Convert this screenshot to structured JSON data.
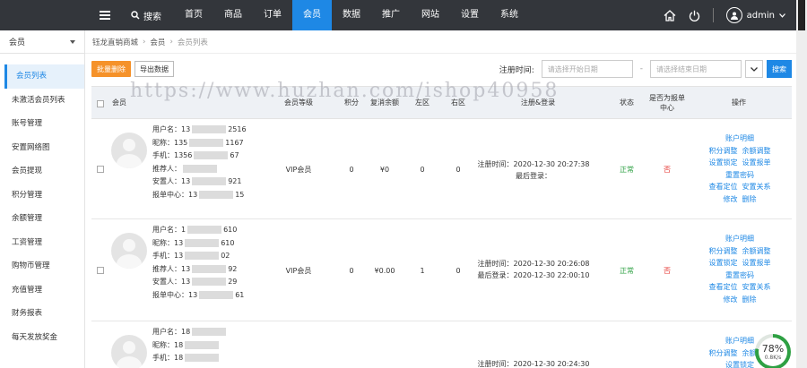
{
  "topbar": {
    "search_label": "搜索",
    "nav": [
      "首页",
      "商品",
      "订单",
      "会员",
      "数据",
      "推广",
      "网站",
      "设置",
      "系统"
    ],
    "active_nav_index": 3,
    "user": "admin"
  },
  "sidebar": {
    "select_value": "会员",
    "items": [
      "会员列表",
      "未激活会员列表",
      "账号管理",
      "安置网络图",
      "会员提现",
      "积分管理",
      "余额管理",
      "工资管理",
      "购物币管理",
      "充值管理",
      "财务报表",
      "每天发放奖金"
    ],
    "active_index": 0
  },
  "breadcrumb": [
    "钰龙直销商城",
    "会员",
    "会员列表"
  ],
  "toolbar": {
    "batch_delete": "批量删除",
    "export": "导出数据",
    "date_label": "注册时间:",
    "start_placeholder": "请选择开始日期",
    "end_placeholder": "请选择结束日期",
    "search": "搜索"
  },
  "watermark": "https://www.huzhan.com/ishop40958",
  "table": {
    "headers": {
      "member": "会员",
      "level": "会员等级",
      "points": "积分",
      "balance": "复消余额",
      "left": "左区",
      "right": "右区",
      "reg_login": "注册&登录",
      "status": "状态",
      "report_center": "是否为报单中心",
      "ops": "操作"
    },
    "info_labels": [
      "用户名：",
      "昵称：",
      "手机：",
      "推荐人：",
      "安置人：",
      "报单中心："
    ],
    "rows": [
      {
        "info": [
          "13",
          "2516",
          "135",
          "1167",
          "1356",
          "67",
          "",
          "",
          "13",
          "921",
          "13",
          "15"
        ],
        "level": "VIP会员",
        "points": "0",
        "balance": "¥0",
        "left": "0",
        "right": "0",
        "reg": "注册时间：2020-12-30 20:27:38",
        "login": "最后登录：",
        "status": "正常",
        "report": "否"
      },
      {
        "info": [
          "1",
          "610",
          "13",
          "610",
          "13",
          "02",
          "13",
          "92",
          "13",
          "29",
          "13",
          "61"
        ],
        "level": "VIP会员",
        "points": "0",
        "balance": "¥0.00",
        "left": "1",
        "right": "0",
        "reg": "注册时间：2020-12-30 20:26:08",
        "login": "最后登录：2020-12-30 22:00:10",
        "status": "正常",
        "report": "否"
      },
      {
        "info": [
          "18",
          "",
          "18",
          "",
          "18",
          ""
        ],
        "level": "",
        "points": "",
        "balance": "",
        "left": "",
        "right": "",
        "reg": "注册时间：2020-12-30 20:24:30",
        "login": "",
        "status": "",
        "report": ""
      }
    ],
    "ops": [
      "账户明细",
      "积分调整",
      "余额调整",
      "设置锁定",
      "设置报单",
      "重置密码",
      "查看定位",
      "安置关系",
      "修改",
      "删除"
    ]
  },
  "progress": {
    "value": 78,
    "label": "78%",
    "speed": "0.8K/s"
  }
}
